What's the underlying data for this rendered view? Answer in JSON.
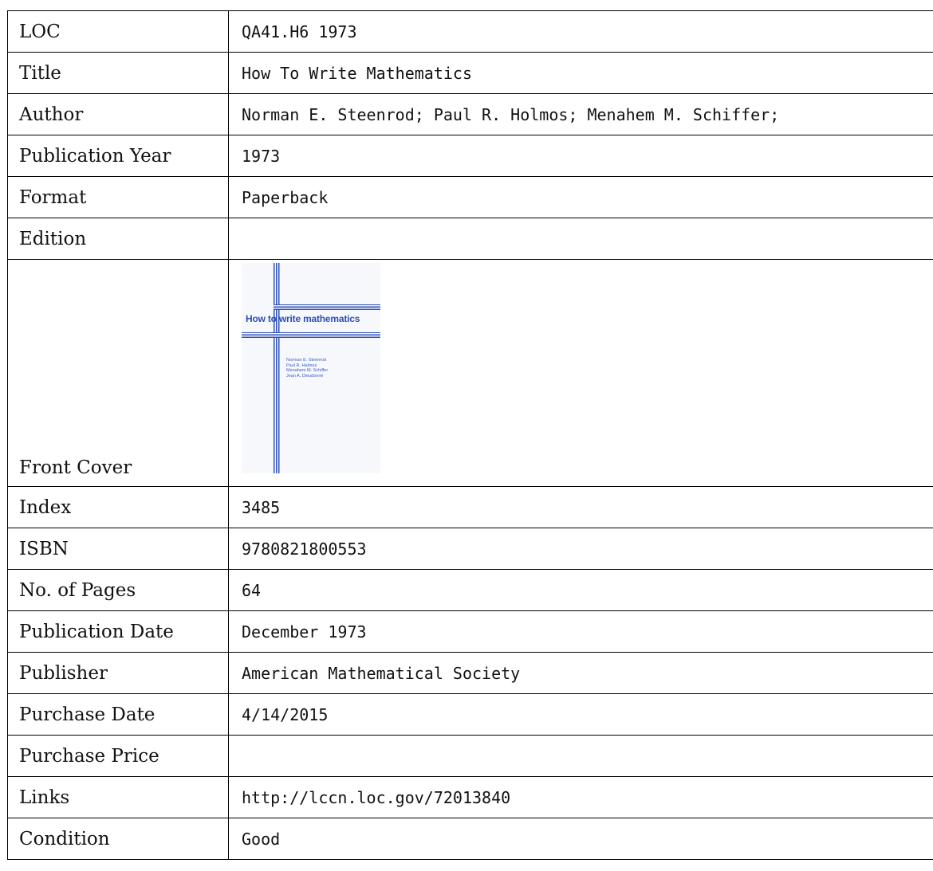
{
  "rows": {
    "loc": {
      "label": "LOC",
      "value": "QA41.H6 1973"
    },
    "title": {
      "label": "Title",
      "value": "How To Write Mathematics"
    },
    "author": {
      "label": "Author",
      "value": "Norman E. Steenrod; Paul R. Holmos; Menahem M. Schiffer;"
    },
    "publication_year": {
      "label": "Publication Year",
      "value": "1973"
    },
    "format": {
      "label": "Format",
      "value": "Paperback"
    },
    "edition": {
      "label": "Edition",
      "value": ""
    },
    "front_cover": {
      "label": "Front Cover"
    },
    "index": {
      "label": "Index",
      "value": "3485"
    },
    "isbn": {
      "label": "ISBN",
      "value": "9780821800553"
    },
    "pages": {
      "label": "No. of Pages",
      "value": "64"
    },
    "publication_date": {
      "label": "Publication Date",
      "value": "December 1973"
    },
    "publisher": {
      "label": "Publisher",
      "value": "American Mathematical Society"
    },
    "purchase_date": {
      "label": "Purchase Date",
      "value": "4/14/2015"
    },
    "purchase_price": {
      "label": "Purchase Price",
      "value": ""
    },
    "links": {
      "label": "Links",
      "value": "http://lccn.loc.gov/72013840"
    },
    "condition": {
      "label": "Condition",
      "value": "Good"
    }
  },
  "cover": {
    "title": "How to write mathematics",
    "authors": [
      "Norman E. Steenrod",
      "Paul R. Halmos",
      "Menahem M. Schiffer",
      "Jean A. Dieudonné"
    ],
    "accent_color": "#2d4fb8",
    "background_color": "#f7f8fb"
  }
}
